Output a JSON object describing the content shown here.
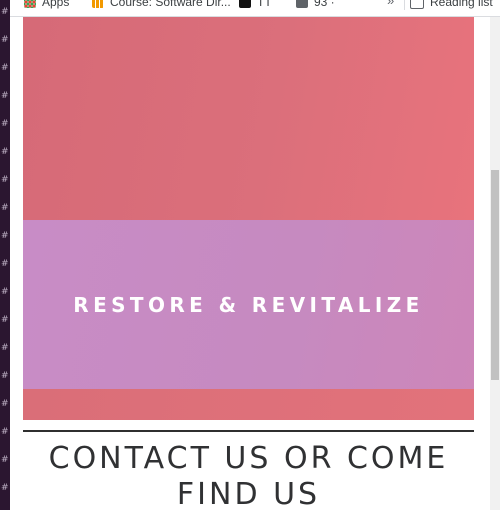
{
  "bookmarks": {
    "items": [
      {
        "label": "Apps",
        "icon": "apps-icon"
      },
      {
        "label": "Course: Software Dir...",
        "icon": "bar-chart-icon"
      },
      {
        "label": "TT",
        "icon": "imdb-icon"
      },
      {
        "label": "93 ·",
        "icon": "globe-icon"
      }
    ],
    "overflow_label": "»",
    "reading_list_label": "Reading list"
  },
  "hero": {
    "band_text": "RESTORE & REVITALIZE"
  },
  "contact": {
    "heading_line1": "CONTACT US OR COME",
    "heading_line2": "FIND US"
  },
  "colors": {
    "hero_coral": "#db6f7b",
    "hero_band_purple": "#c88cc6",
    "heading_text": "#303133",
    "divider": "#2f2f2f"
  }
}
